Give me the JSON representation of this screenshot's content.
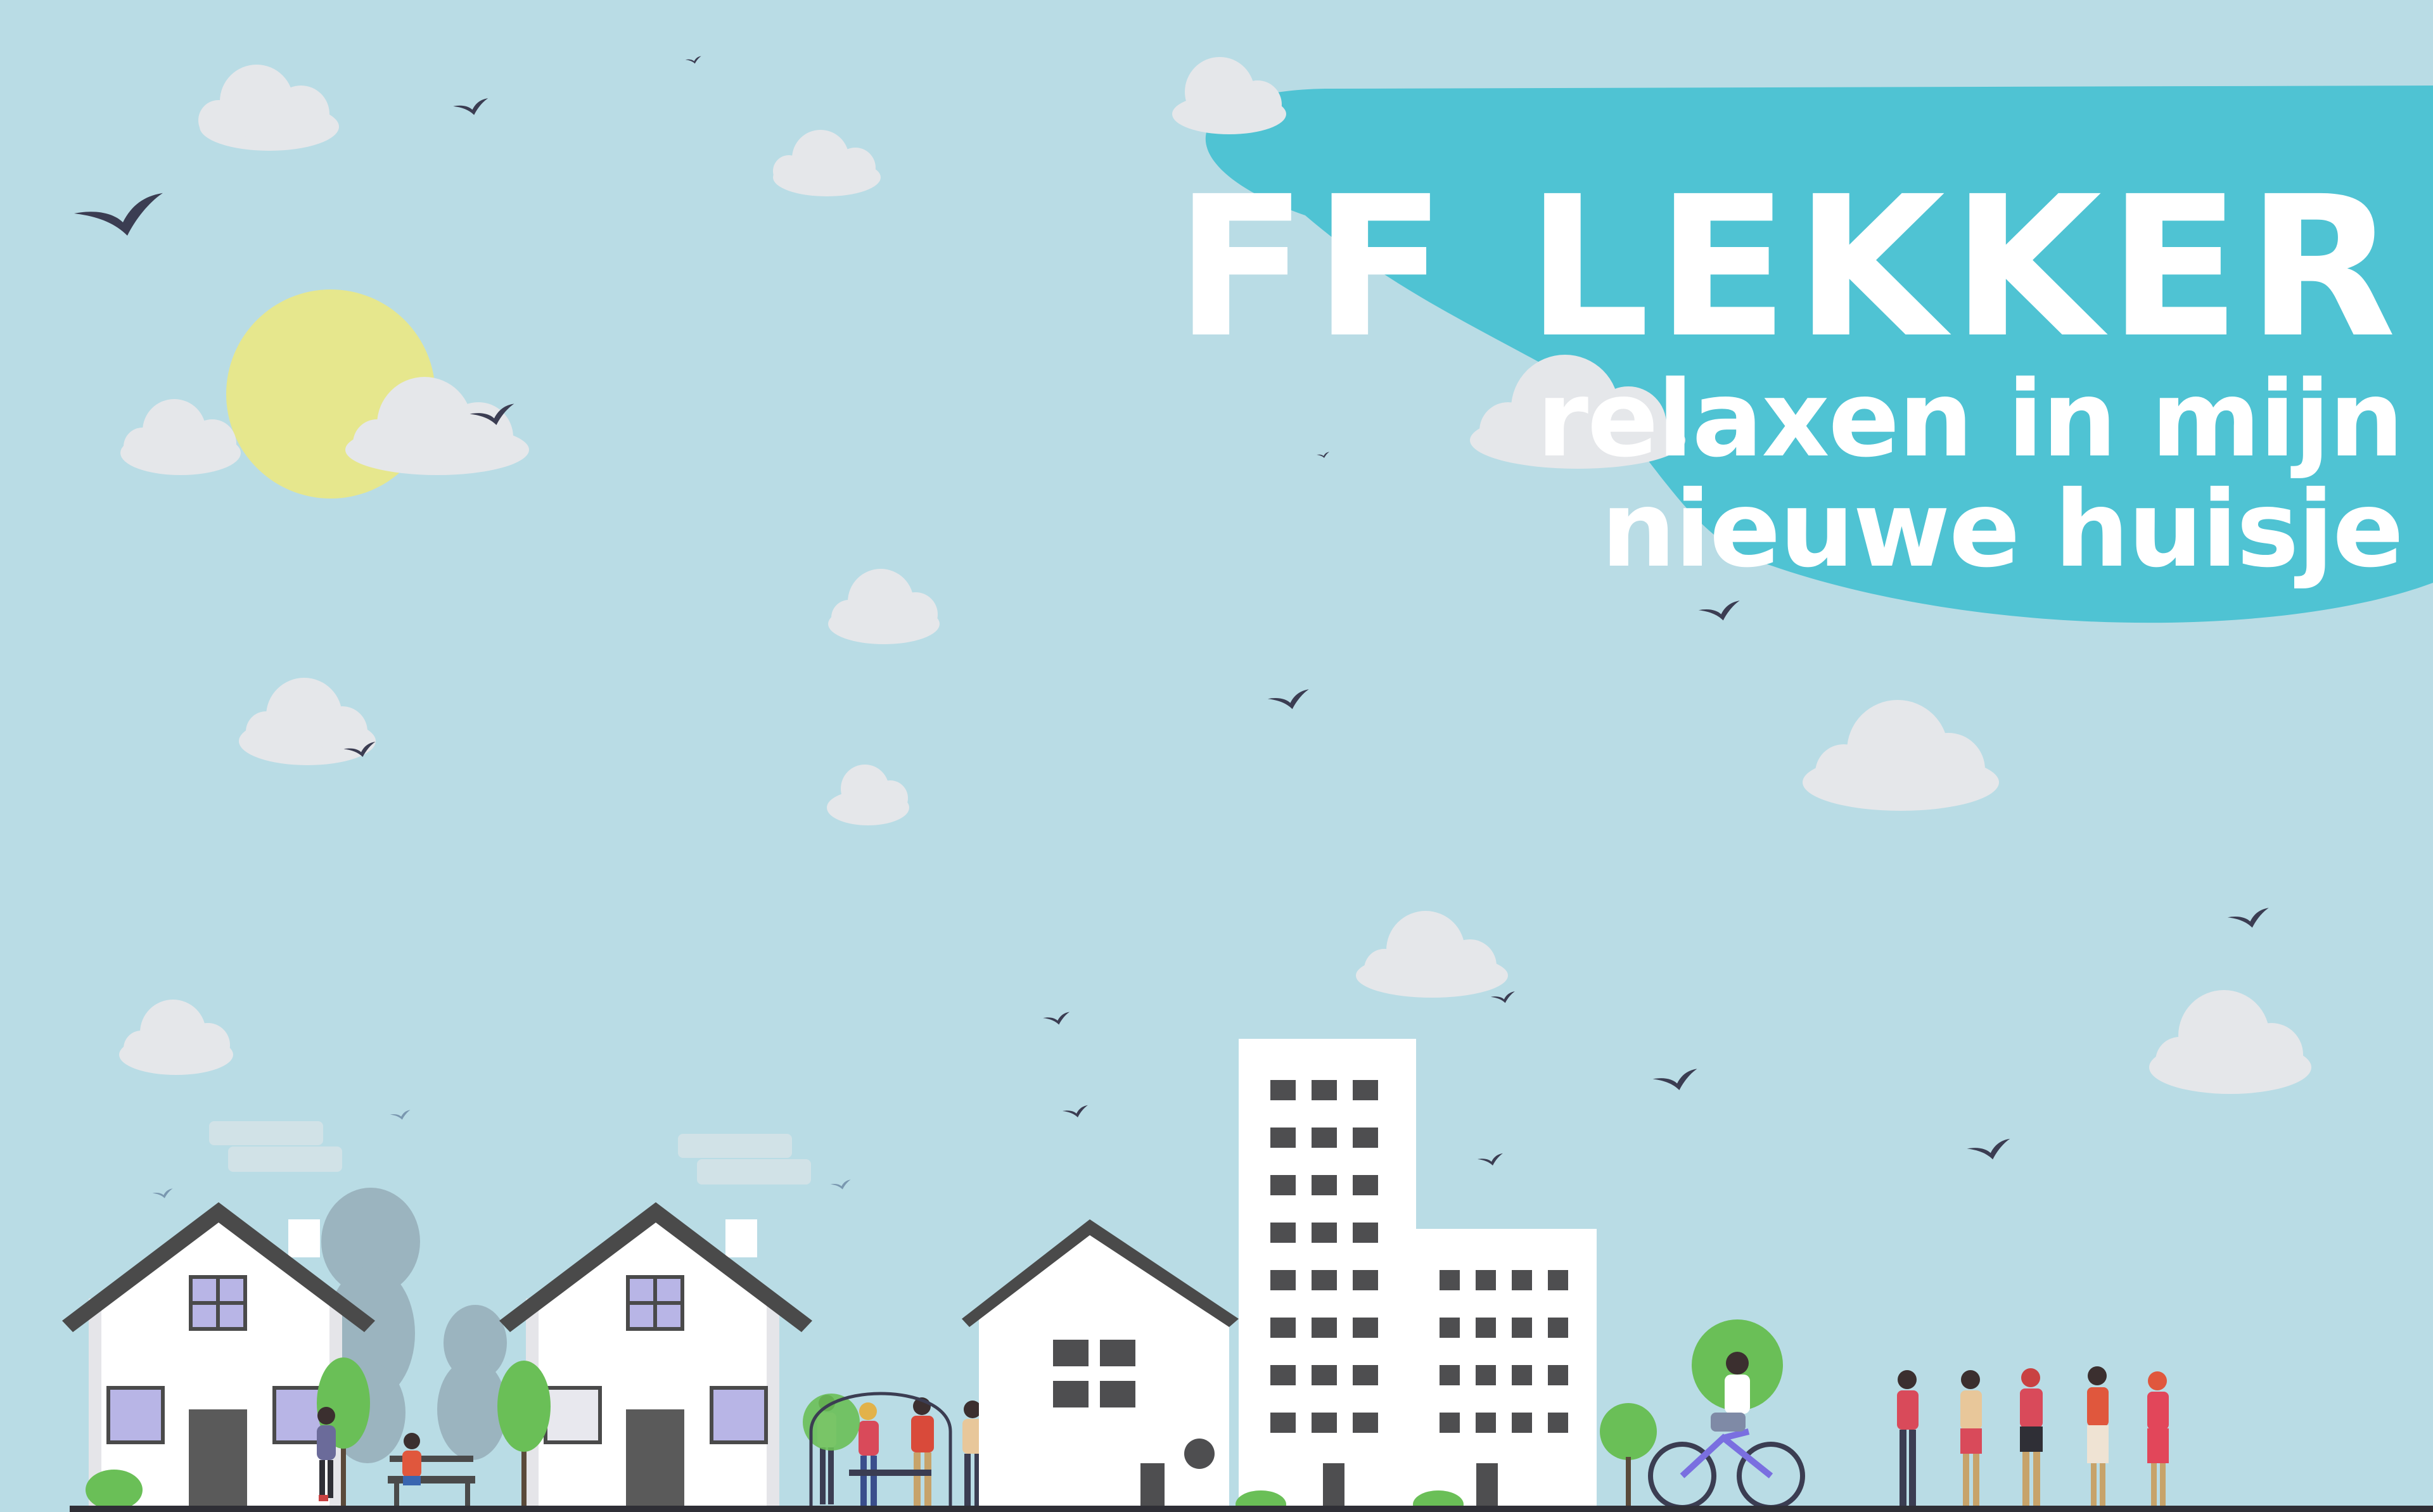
{
  "colors": {
    "sky": "#b9dce5",
    "title_blob": "#4fc3d3",
    "sun": "#e6e78d",
    "cloud": "#e5e7ea",
    "bird": "#3b3d52",
    "house_wall": "#ffffff",
    "roof": "#4a4a4a",
    "window_glass": "#b8b5e6",
    "building_window": "#4e4e50",
    "tree_green": "#6abf57",
    "tree_grey": "#9bb4bf",
    "ground": "#2f2f36"
  },
  "headline": {
    "title": "FF LEKKER",
    "subtitle_line1": "relaxen in mijn",
    "subtitle_line2": "nieuwe huisje"
  }
}
